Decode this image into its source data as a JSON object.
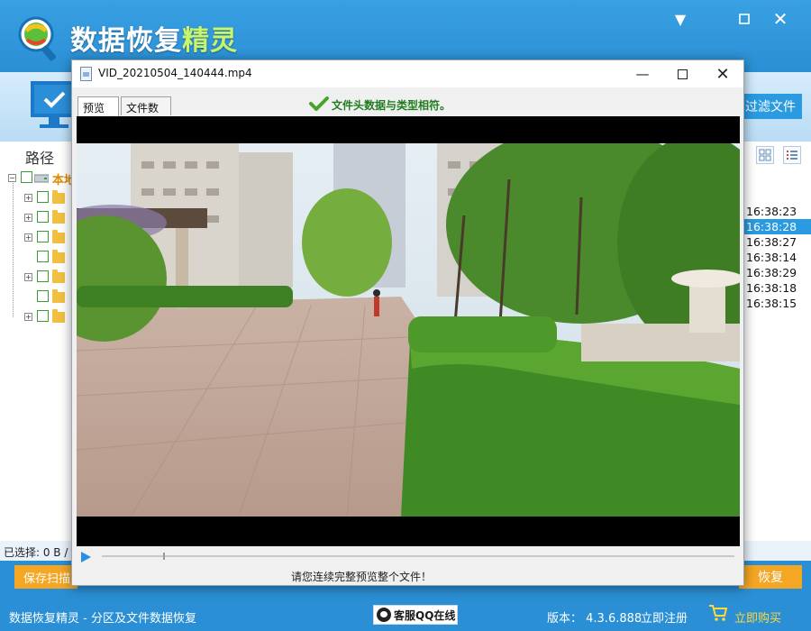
{
  "app": {
    "title_main": "数据恢复",
    "title_accent": "精灵",
    "filter_button": "过滤文件",
    "path_header": "路径",
    "root_label": "本地",
    "times": [
      "16:38:23",
      "16:38:28",
      "16:38:27",
      "16:38:14",
      "16:38:29",
      "16:38:18",
      "16:38:15"
    ],
    "selected_index": 1,
    "selected_label": "已选择: 0 B /",
    "save_scan": "保存扫描",
    "recover": "恢复",
    "footer_text": "数据恢复精灵 - 分区及文件数据恢复",
    "qq_label": "客服QQ在线",
    "version": "版本： 4.3.6.888",
    "register": "立即注册",
    "buy": "立即购买",
    "colors": {
      "brand_blue": "#2a8fd4",
      "accent_orange": "#f5a623",
      "title_green": "#c8f56a"
    }
  },
  "dialog": {
    "title": "VID_20210504_140444.mp4",
    "tabs": [
      "预览",
      "文件数据"
    ],
    "match_text": "文件头数据与类型相符。",
    "hint": "请您连续完整预览整个文件！"
  }
}
